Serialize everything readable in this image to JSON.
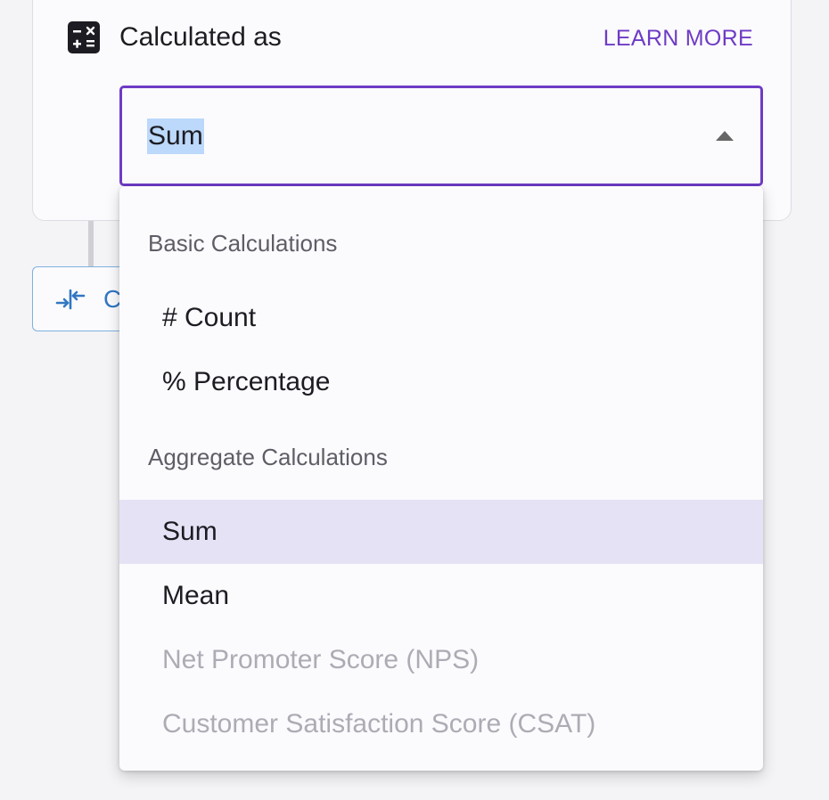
{
  "card": {
    "title": "Calculated as",
    "learn_more": "LEARN MORE",
    "icon": "calculator-icon"
  },
  "select": {
    "value": "Sum",
    "state": "open"
  },
  "behind_button": {
    "icon": "merge-arrows-icon",
    "label_visible": "C"
  },
  "dropdown": {
    "groups": [
      {
        "header": "Basic Calculations",
        "options": [
          {
            "label": "# Count",
            "state": "enabled"
          },
          {
            "label": "% Percentage",
            "state": "enabled"
          }
        ]
      },
      {
        "header": "Aggregate Calculations",
        "options": [
          {
            "label": "Sum",
            "state": "selected"
          },
          {
            "label": "Mean",
            "state": "enabled"
          },
          {
            "label": "Net Promoter Score (NPS)",
            "state": "disabled"
          },
          {
            "label": "Customer Satisfaction Score (CSAT)",
            "state": "disabled"
          }
        ]
      }
    ]
  },
  "colors": {
    "accent": "#6e3bc5",
    "selection_highlight": "#bcd8fa",
    "selected_option_bg": "#e6e2f5",
    "disabled_text": "#acacb4",
    "link_blue": "#3277c2"
  }
}
